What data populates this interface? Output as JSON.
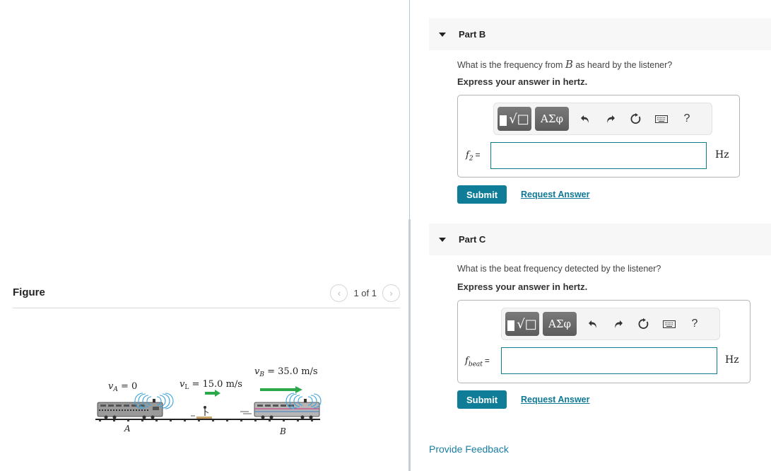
{
  "figure": {
    "title": "Figure",
    "pager_text": "1 of 1",
    "prev_icon": "chevron-left-icon",
    "next_icon": "chevron-right-icon",
    "labels": {
      "vA": "v",
      "vA_sub": "A",
      "vA_value": " = 0",
      "vL": "v",
      "vL_sub": "L",
      "vL_value": " = 15.0 m/s",
      "vB": "v",
      "vB_sub": "B",
      "vB_value": " = 35.0 m/s",
      "train_A": "A",
      "train_B": "B"
    },
    "colors": {
      "arrow": "#2aa84a",
      "sound_waves": "#3aa2dc",
      "stripe_pink": "#d0307a",
      "stripe_blue": "#3a80c8"
    }
  },
  "parts": [
    {
      "title": "Part B",
      "question_prefix": "What is the frequency from ",
      "question_var": "B",
      "question_suffix": " as heard by the listener?",
      "instruction": "Express your answer in hertz.",
      "variable": "f",
      "variable_sub": "2",
      "equals": "=",
      "input_value": "",
      "unit": "Hz",
      "submit_label": "Submit",
      "request_label": "Request Answer"
    },
    {
      "title": "Part C",
      "question_prefix": "What is the beat frequency detected by the listener?",
      "question_var": "",
      "question_suffix": "",
      "instruction": "Express your answer in hertz.",
      "variable": "f",
      "variable_sub": "beat",
      "equals": "=",
      "input_value": "",
      "unit": "Hz",
      "submit_label": "Submit",
      "request_label": "Request Answer"
    }
  ],
  "toolbar": {
    "greek_label": "ΑΣφ",
    "help_label": "?",
    "icons": [
      "templates-icon",
      "greek-symbols-icon",
      "undo-icon",
      "redo-icon",
      "reset-icon",
      "keyboard-icon",
      "help-icon"
    ]
  },
  "feedback_label": "Provide Feedback",
  "colors": {
    "accent": "#0f7d98",
    "link": "#0e7896",
    "input_border": "#137a8f"
  }
}
